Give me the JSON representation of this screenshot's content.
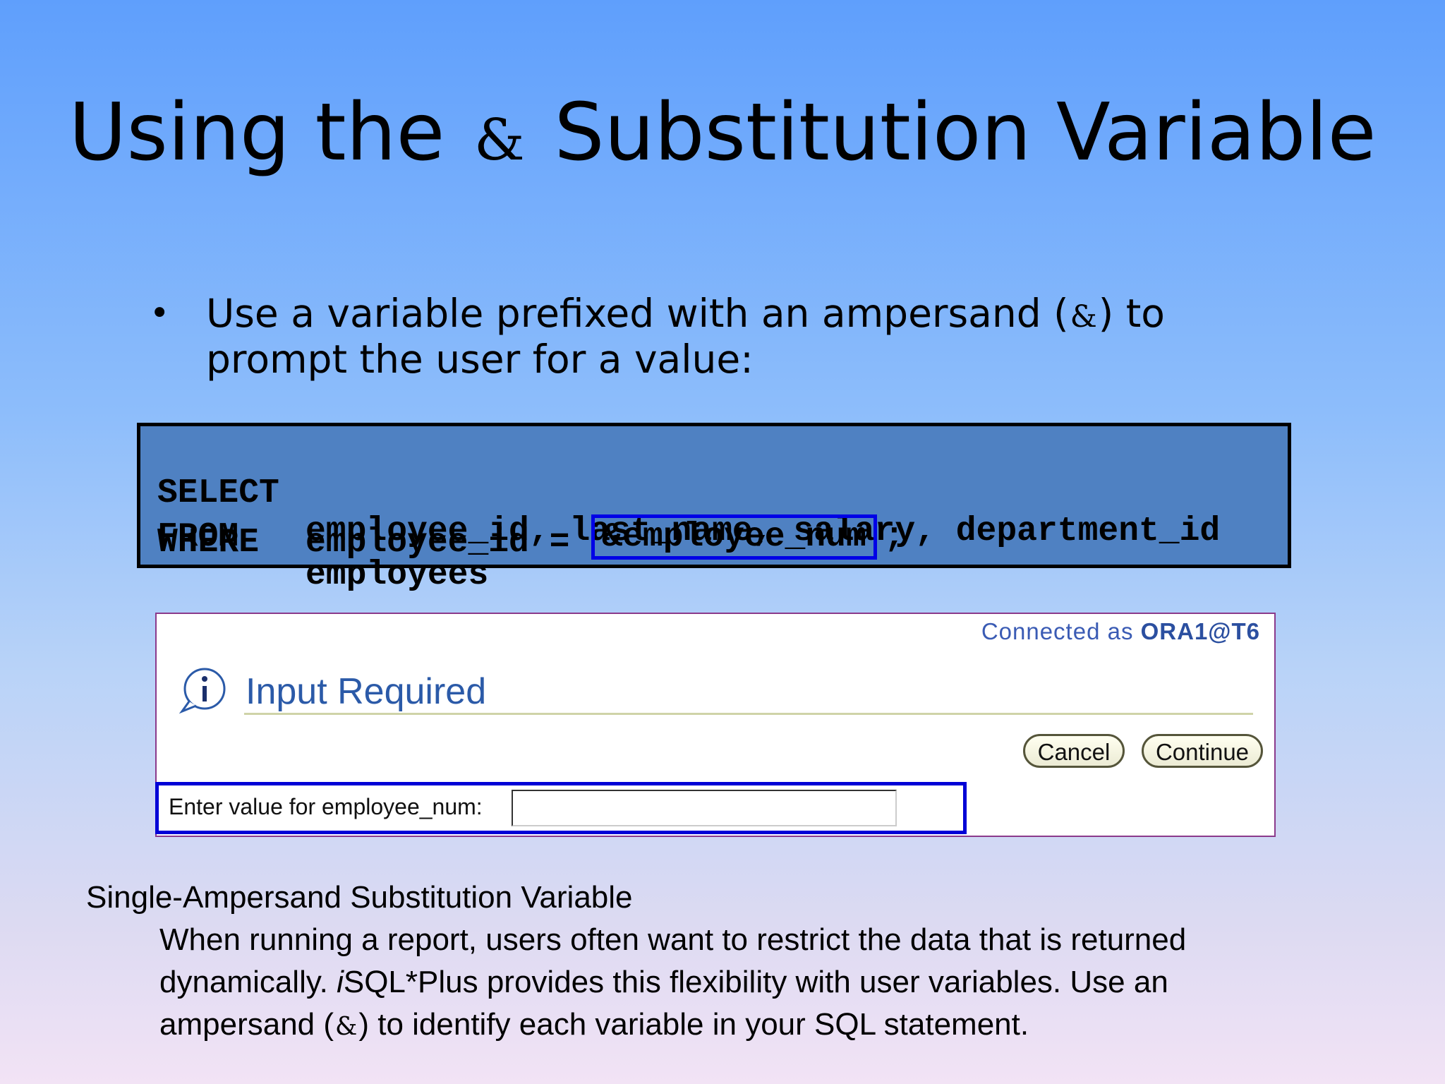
{
  "slide": {
    "title_before": "Using the",
    "title_amp": "&",
    "title_after": "Substitution Variable",
    "bullet_before": "Use a variable prefixed with an ampersand (",
    "bullet_amp": "&",
    "bullet_after": ") to prompt the user for a value:"
  },
  "code": {
    "line1_kw": "SELECT",
    "line1_rest": "employee_id, last_name, salary, department_id",
    "line2_kw": "FROM",
    "line2_rest": "employees",
    "line3_kw": "WHERE",
    "line3_rest": "employee_id =",
    "line3_var": "&employee_num",
    "line3_end": ";"
  },
  "dialog": {
    "connected_prefix": "Connected as",
    "connected_user": "ORA1@T6",
    "icon": "info-icon",
    "title": "Input Required",
    "cancel_label": "Cancel",
    "continue_label": "Continue",
    "enter_label": "Enter value for employee_num:",
    "enter_value": ""
  },
  "notes": {
    "heading": "Single-Ampersand Substitution Variable",
    "body_part1": "When running a report, users often want to restrict the data that is returned dynamically.",
    "body_italic": "i",
    "body_part2": "SQL*Plus provides this flexibility with user variables. Use an ampersand (",
    "body_amp": "&",
    "body_part3": ") to identify each variable in your SQL statement."
  },
  "colors": {
    "code_bg": "#4f81c2",
    "highlight_border": "#0000e6",
    "dialog_title": "#2b5aa8"
  }
}
